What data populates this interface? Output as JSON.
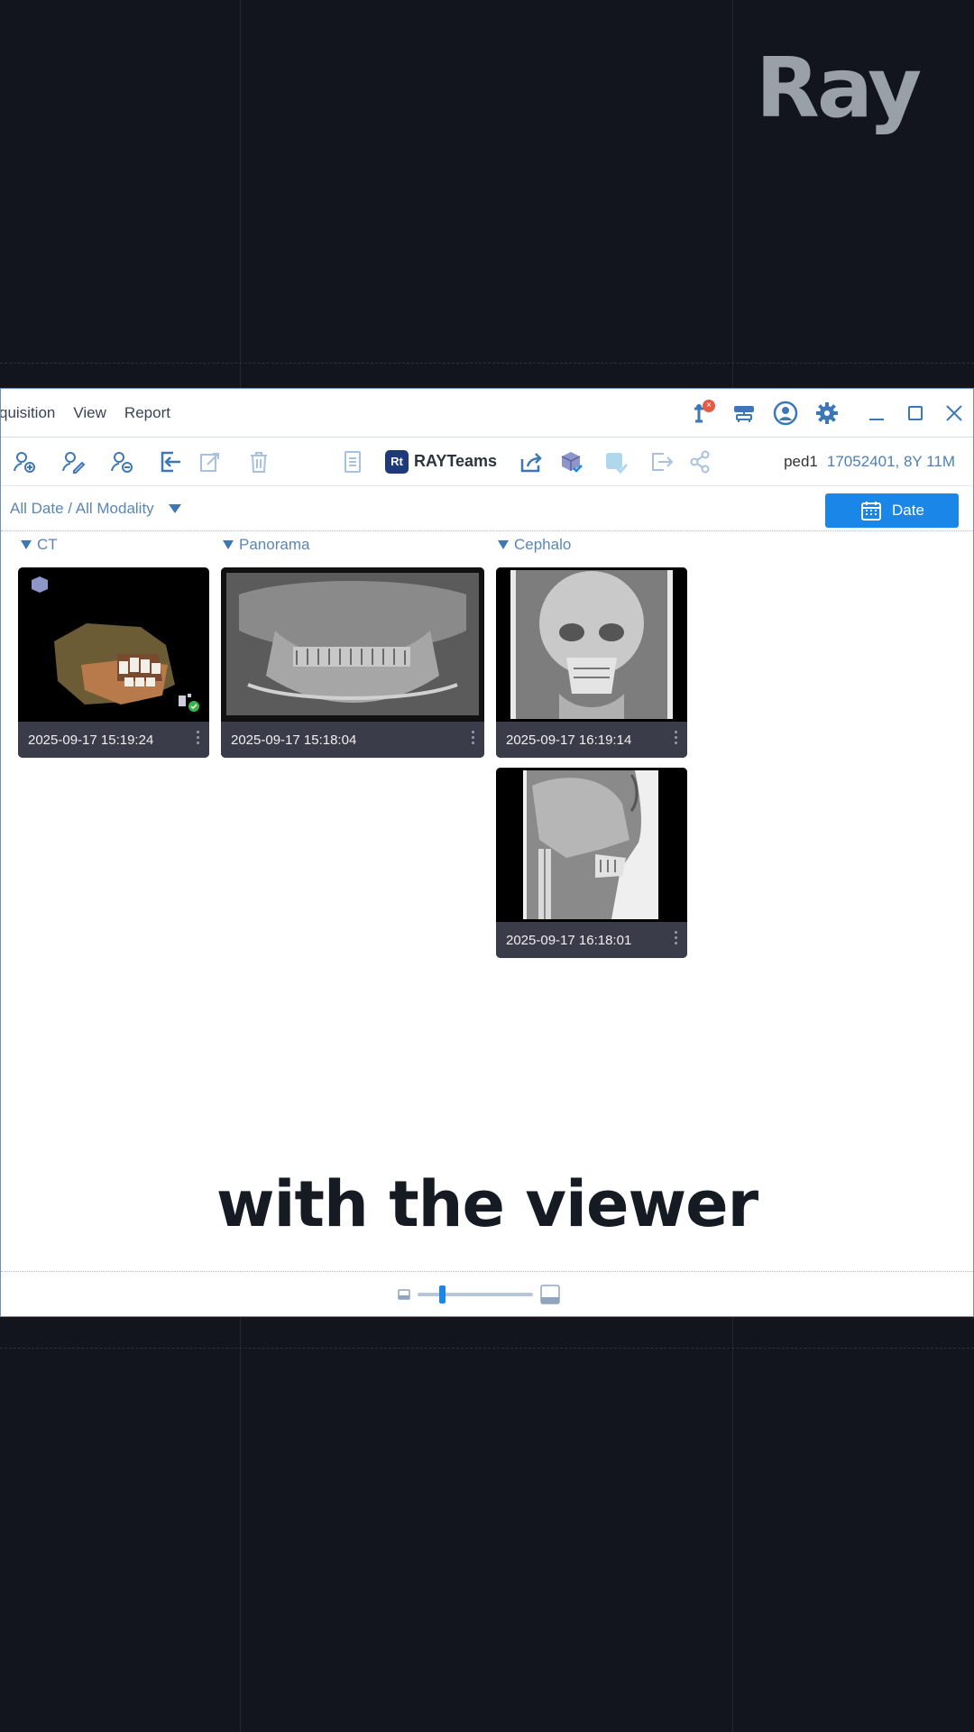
{
  "brand": {
    "logo_text": "Ray"
  },
  "menu": {
    "items": [
      "quisition",
      "View",
      "Report"
    ]
  },
  "titlebar": {
    "icons": [
      "scanner-status-icon",
      "network-icon",
      "user-account-icon",
      "settings-gear-icon"
    ],
    "badge_value": "×"
  },
  "toolbar": {
    "rayteams_logo": "Rt",
    "rayteams_label": "RAYTeams"
  },
  "patient": {
    "name": "ped1",
    "info": "17052401, 8Y 11M"
  },
  "filter": {
    "text": "All Date / All Modality",
    "date_button": "Date"
  },
  "groups": [
    {
      "name": "CT",
      "items": [
        {
          "timestamp": "2025-09-17 15:19:24"
        }
      ]
    },
    {
      "name": "Panorama",
      "items": [
        {
          "timestamp": "2025-09-17 15:18:04"
        }
      ]
    },
    {
      "name": "Cephalo",
      "items": [
        {
          "timestamp": "2025-09-17 16:19:14"
        },
        {
          "timestamp": "2025-09-17 16:18:01"
        }
      ]
    }
  ],
  "caption": "with the viewer",
  "zoom": {
    "level": 0.2
  },
  "colors": {
    "accent": "#1a86e8",
    "link": "#5a86b6",
    "background": "#12151d"
  }
}
